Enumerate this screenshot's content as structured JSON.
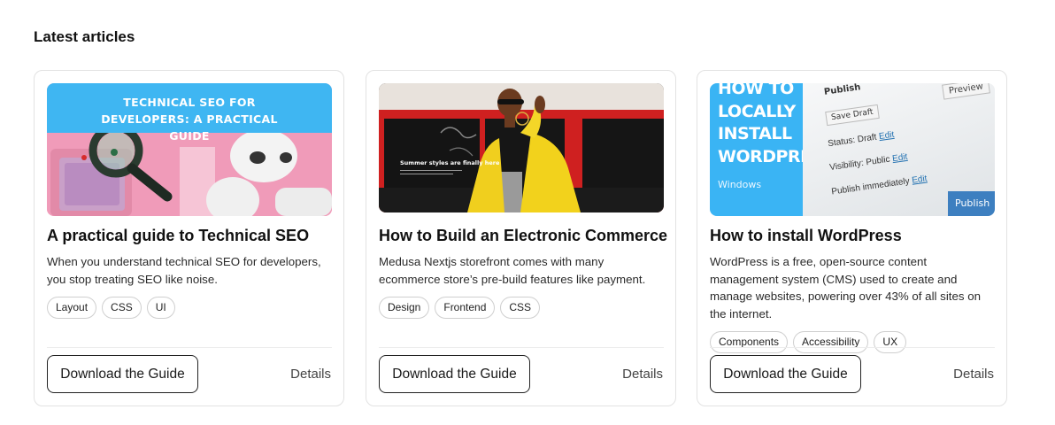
{
  "section": {
    "title": "Latest articles"
  },
  "cards": [
    {
      "image": {
        "overlay_title": "TECHNICAL SEO FOR DEVELOPERS: A PRACTICAL GUIDE"
      },
      "title": "A practical guide to Technical SEO",
      "description": "When you understand technical SEO for developers, you stop treating SEO like noise.",
      "tags": [
        "Layout",
        "CSS",
        "UI"
      ],
      "cta_label": "Download the Guide",
      "details_label": "Details"
    },
    {
      "image": {
        "overlay_title": "Summer styles are finally here"
      },
      "title": "How to Build an Electronic Commerce",
      "description": "Medusa Nextjs storefront comes with many ecommerce store’s pre-build features like payment.",
      "tags": [
        "Design",
        "Frontend",
        "CSS"
      ],
      "cta_label": "Download the Guide",
      "details_label": "Details"
    },
    {
      "image": {
        "overlay_title": "HOW TO LOCALLY INSTALL WORDPRESS",
        "overlay_subtitle": "Windows",
        "ui_preview": "Preview",
        "ui_publish_heading": "Publish",
        "ui_save_draft": "Save Draft",
        "ui_status": "Status: Draft",
        "ui_visibility": "Visibility: Public",
        "ui_publish_when": "Publish immediately",
        "ui_edit": "Edit",
        "ui_publish_button": "Publish"
      },
      "title": "How to install WordPress",
      "description": "WordPress is a free, open-source content management system (CMS) used to create and manage websites, powering over 43% of all sites on the internet.",
      "tags": [
        "Components",
        "Accessibility",
        "UX"
      ],
      "cta_label": "Download the Guide",
      "details_label": "Details"
    }
  ],
  "colors": {
    "card_border": "#e2e2e2",
    "seo_banner": "#3fb6f2",
    "seo_bg": "#f0a8c2",
    "commerce_red": "#d42424",
    "commerce_jacket": "#f2d21c",
    "wp_blue": "#3ab4f4"
  }
}
